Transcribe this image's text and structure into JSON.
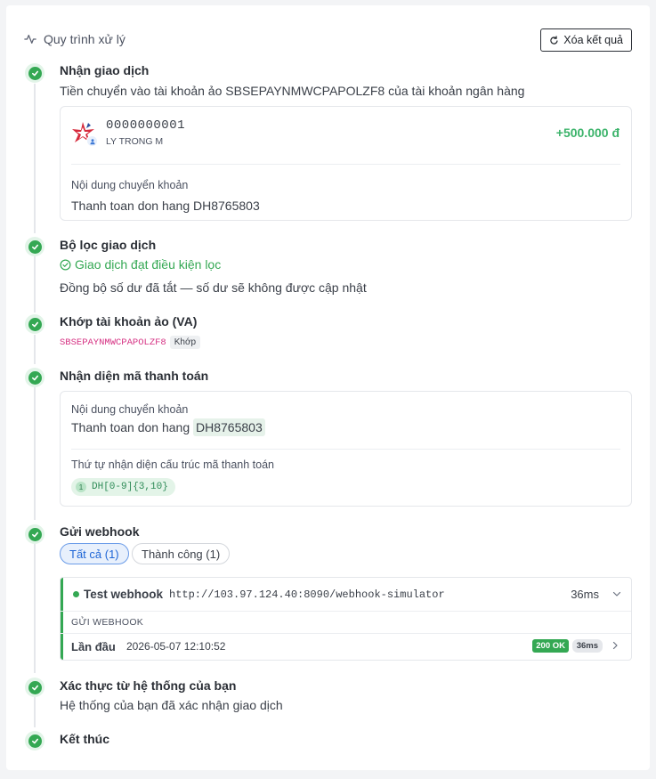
{
  "header": {
    "title": "Quy trình xử lý",
    "clear_label": "Xóa kết quả"
  },
  "steps": {
    "receive": {
      "title": "Nhận giao dịch",
      "text": "Tiền chuyển vào tài khoản ảo SBSEPAYNMWCPAPOLZF8 của tài khoản ngân hàng",
      "account_number": "0000000001",
      "account_name": "LY TRONG M",
      "amount": "+500.000 đ",
      "content_label": "Nội dung chuyển khoản",
      "content_value": "Thanh toan don hang DH8765803"
    },
    "filter": {
      "title": "Bộ lọc giao dịch",
      "status": "Giao dịch đạt điều kiện lọc",
      "note": "Đồng bộ số dư đã tắt — số dư sẽ không được cập nhật"
    },
    "va": {
      "title": "Khớp tài khoản ảo (VA)",
      "code": "SBSEPAYNMWCPAPOLZF8",
      "match_label": "Khớp"
    },
    "payment_code": {
      "title": "Nhận diện mã thanh toán",
      "content_label": "Nội dung chuyển khoản",
      "content_prefix": "Thanh toan don hang",
      "content_code": "DH8765803",
      "order_label": "Thứ tự nhận diện cấu trúc mã thanh toán",
      "pattern_index": "1",
      "pattern": "DH[0-9]{3,10}"
    },
    "webhook": {
      "title": "Gửi webhook",
      "filter_all": "Tất cả (1)",
      "filter_success": "Thành công (1)",
      "name": "Test webhook",
      "url": "http://103.97.124.40:8090/webhook-simulator",
      "duration": "36ms",
      "section_label": "GỬI WEBHOOK",
      "attempt_label": "Lần đầu",
      "attempt_time": "2026-05-07 12:10:52",
      "status_badge": "200 OK",
      "attempt_duration": "36ms"
    },
    "verify": {
      "title": "Xác thực từ hệ thống của bạn",
      "text": "Hệ thống của bạn đã xác nhận giao dịch"
    },
    "end": {
      "title": "Kết thúc"
    }
  },
  "colors": {
    "success": "#34a853",
    "amount": "#3bb36a",
    "accent_blue": "#1f66d6",
    "code_pink": "#d63384"
  }
}
